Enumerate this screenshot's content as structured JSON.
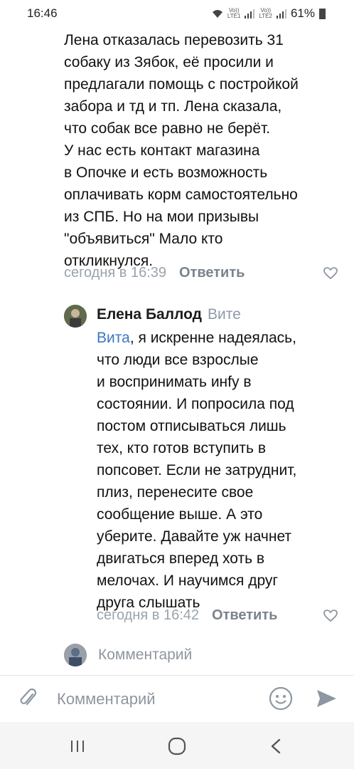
{
  "status_bar": {
    "time": "16:46",
    "sim1_label": "Vo))\nLTE1",
    "sim2_label": "Vo))\nLTE2",
    "battery": "61%"
  },
  "comment1": {
    "lines": [
      "Лена отказалась перевозить 31",
      "собаку из Зябок, её просили и",
      "предлагали помощь с постройкой",
      "забора и тд и тп. Лена сказала,",
      "что собак все равно не берёт.",
      "У нас есть контакт магазина",
      "в Опочке и есть возможность",
      "оплачивать корм самостоятельно",
      "из СПБ. Но на мои призывы",
      "\"объявиться\" Мало кто",
      "откликнулся."
    ],
    "timestamp": "сегодня в 16:39",
    "reply_label": "Ответить"
  },
  "comment2": {
    "author": "Елена Баллод",
    "reply_to": "Вите",
    "mention": "Вита",
    "lines": [
      ", я искренне надеялась,",
      "что люди все взрослые",
      "и воспринимать инfу в",
      "состоянии. И попросила под",
      "постом отписываться лишь",
      "тех, кто готов вступить в",
      "попсовет. Если не затруднит,",
      "плиз, перенесите свое",
      "сообщение выше. А это",
      "уберите. Давайте уж начнет",
      "двигаться вперед хоть в",
      "мелочах. И научимся друг",
      "друга слышать"
    ],
    "timestamp": "сегодня в 16:42",
    "reply_label": "Ответить"
  },
  "inline_reply": {
    "placeholder": "Комментарий"
  },
  "composer": {
    "placeholder": "Комментарий"
  }
}
